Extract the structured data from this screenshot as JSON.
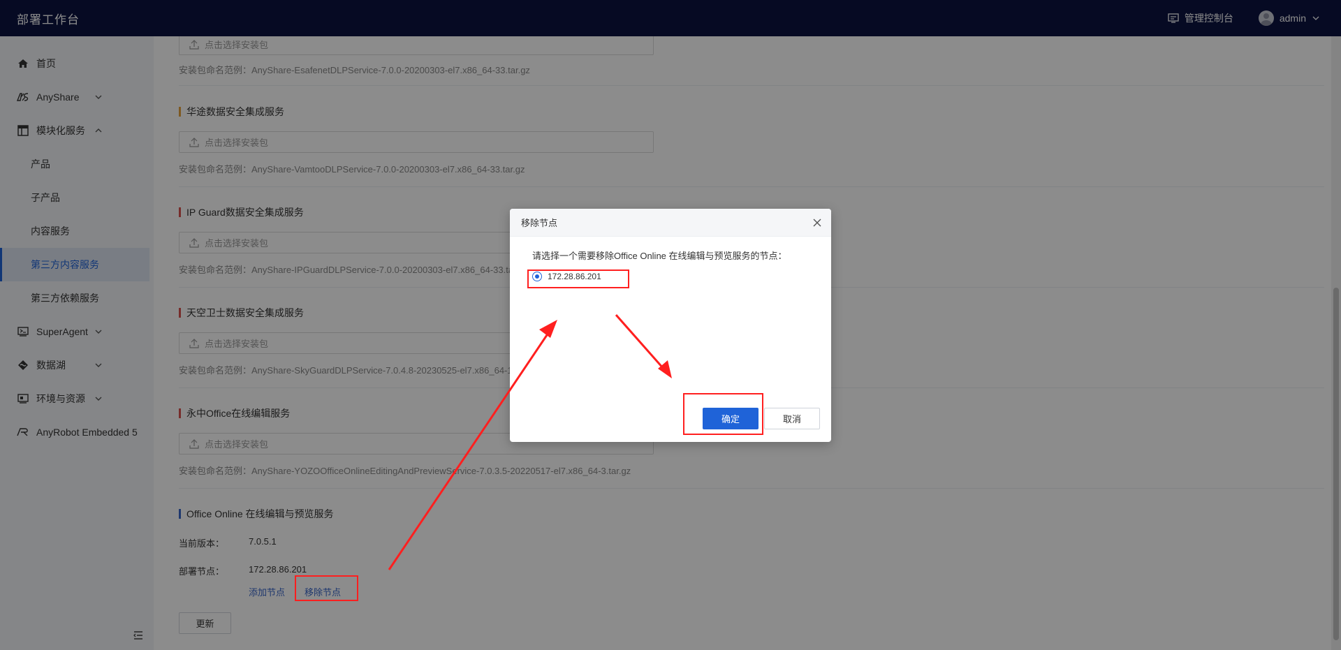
{
  "header": {
    "title": "部署工作台",
    "console_label": "管理控制台",
    "user_name": "admin"
  },
  "sidebar": {
    "items": [
      {
        "label": "首页",
        "icon": "home-icon"
      },
      {
        "label": "AnyShare",
        "icon": "anyshare-icon"
      },
      {
        "label": "模块化服务",
        "icon": "module-icon"
      },
      {
        "label": "产品"
      },
      {
        "label": "子产品"
      },
      {
        "label": "内容服务"
      },
      {
        "label": "第三方内容服务",
        "active": true
      },
      {
        "label": "第三方依赖服务"
      },
      {
        "label": "SuperAgent",
        "icon": "superagent-icon"
      },
      {
        "label": "数据湖",
        "icon": "datalake-icon"
      },
      {
        "label": "环境与资源",
        "icon": "environment-icon"
      },
      {
        "label": "AnyRobot Embedded 5",
        "icon": "anyrobot-icon"
      }
    ]
  },
  "main": {
    "upload_placeholder": "点击选择安装包",
    "sections": [
      {
        "hint": "安装包命名范例：AnyShare-EsafenetDLPService-7.0.0-20200303-el7.x86_64-33.tar.gz"
      },
      {
        "title": "华途数据安全集成服务",
        "hint": "安装包命名范例：AnyShare-VamtooDLPService-7.0.0-20200303-el7.x86_64-33.tar.gz"
      },
      {
        "title": "IP Guard数据安全集成服务",
        "hint": "安装包命名范例：AnyShare-IPGuardDLPService-7.0.0-20200303-el7.x86_64-33.tar.gz"
      },
      {
        "title": "天空卫士数据安全集成服务",
        "hint": "安装包命名范例：AnyShare-SkyGuardDLPService-7.0.4.8-20230525-el7.x86_64-1.tar.gz"
      },
      {
        "title": "永中Office在线编辑服务",
        "hint": "安装包命名范例：AnyShare-YOZOOfficeOnlineEditingAndPreviewService-7.0.3.5-20220517-el7.x86_64-3.tar.gz"
      }
    ],
    "office": {
      "title": "Office Online 在线编辑与预览服务",
      "version_label": "当前版本：",
      "version_value": "7.0.5.1",
      "node_label": "部署节点：",
      "node_value": "172.28.86.201",
      "add_node": "添加节点",
      "remove_node": "移除节点",
      "update": "更新"
    }
  },
  "modal": {
    "title": "移除节点",
    "description": "请选择一个需要移除Office Online 在线编辑与预览服务的节点：",
    "option": "172.28.86.201",
    "ok": "确定",
    "cancel": "取消"
  },
  "colors": {
    "header_bg": "#0b1340",
    "primary": "#1f63d8",
    "annotation": "#ff1f1f",
    "bar_orange": "#e6a23c",
    "bar_red": "#d9534f",
    "bar_blue": "#3a66c9"
  }
}
